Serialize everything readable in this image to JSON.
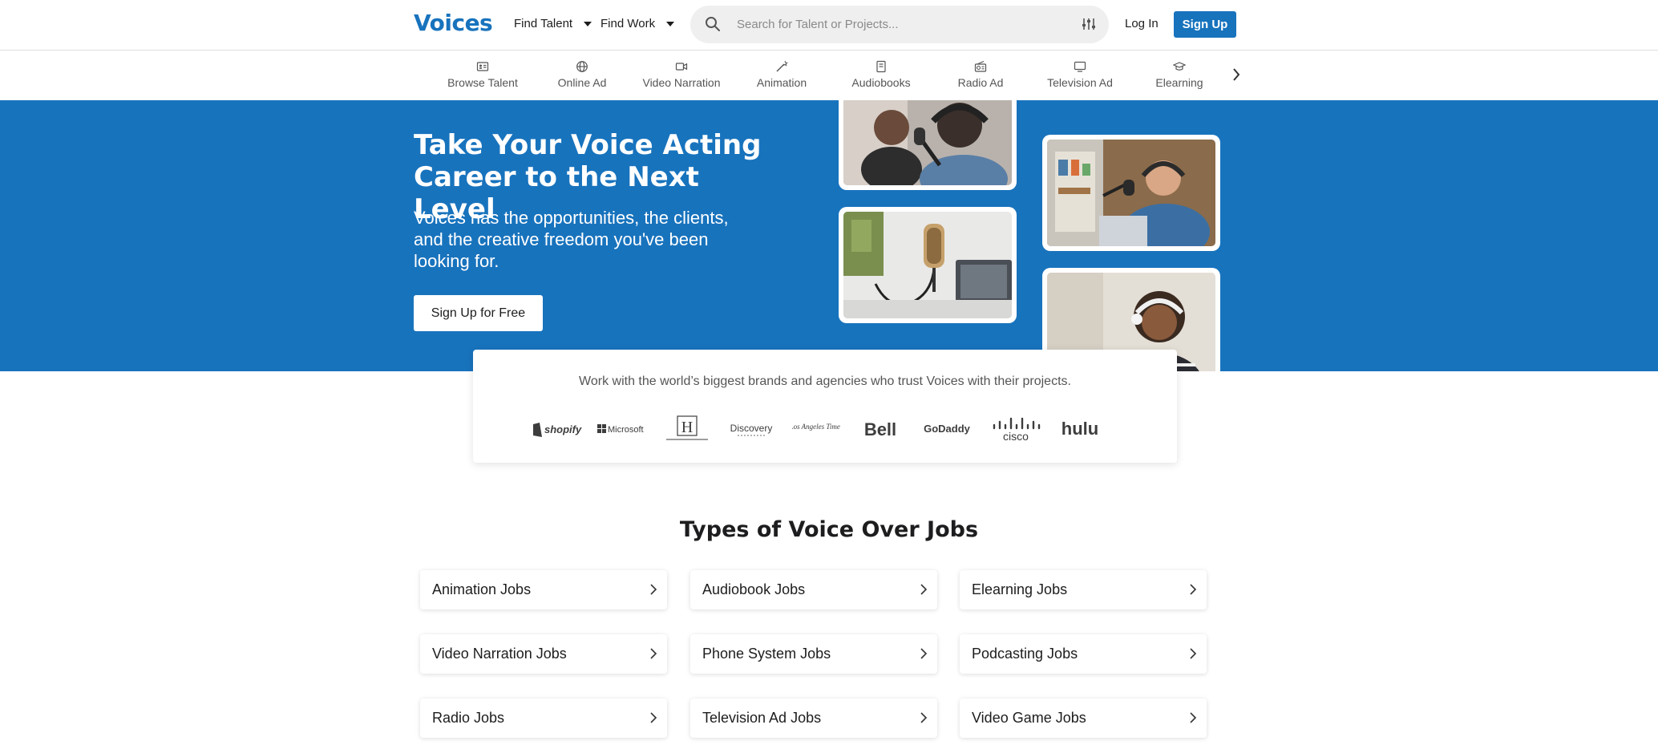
{
  "header": {
    "logo": "Voices",
    "find_talent": "Find Talent",
    "find_work": "Find Work",
    "search_placeholder": "Search for Talent or Projects...",
    "login": "Log In",
    "signup": "Sign Up"
  },
  "categories": [
    {
      "label": "Browse Talent",
      "icon": "id-card-icon"
    },
    {
      "label": "Online Ad",
      "icon": "globe-icon"
    },
    {
      "label": "Video Narration",
      "icon": "video-camera-icon"
    },
    {
      "label": "Animation",
      "icon": "magic-wand-icon"
    },
    {
      "label": "Audiobooks",
      "icon": "book-icon"
    },
    {
      "label": "Radio Ad",
      "icon": "radio-icon"
    },
    {
      "label": "Television Ad",
      "icon": "tv-icon"
    },
    {
      "label": "Elearning",
      "icon": "graduation-cap-icon"
    }
  ],
  "hero": {
    "title": "Take Your Voice Acting Career to the Next Level",
    "subtitle": "Voices has the opportunities, the clients, and the creative freedom you've been looking for.",
    "cta": "Sign Up for Free"
  },
  "brands": {
    "text": "Work with the world’s biggest brands and agencies who trust Voices with their projects.",
    "logos": [
      "shopify",
      "Microsoft",
      "H",
      "Discovery",
      "Los Angeles Times",
      "Bell",
      "GoDaddy",
      "cisco",
      "hulu"
    ]
  },
  "jobs": {
    "title": "Types of Voice Over Jobs",
    "items": [
      "Animation Jobs",
      "Audiobook Jobs",
      "Elearning Jobs",
      "Video Narration Jobs",
      "Phone System Jobs",
      "Podcasting Jobs",
      "Radio Jobs",
      "Television Ad Jobs",
      "Video Game Jobs"
    ]
  },
  "colors": {
    "brand_blue": "#1873bd",
    "text_dark": "#1d1d1f",
    "text_muted": "#555555"
  }
}
